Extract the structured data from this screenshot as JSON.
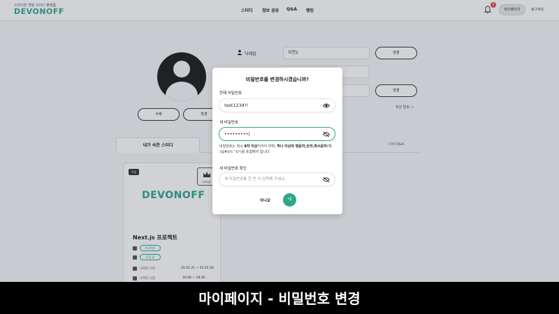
{
  "header": {
    "brand_tagline": "스터디한 개발 스터디 플랫폼",
    "brand_logo": "DEVONOFF",
    "nav": [
      "스터디",
      "정보 공유",
      "Q&A",
      "랭킹"
    ],
    "notification_count": "3",
    "mypage_label": "마이페이지",
    "logout_label": "로그아웃"
  },
  "profile": {
    "delete_label": "삭제",
    "change_label": "변경",
    "nickname_label": "닉네임",
    "nickname_value": "지연2",
    "edit_nickname_label": "변경",
    "edit_password_label": "변경",
    "withdraw_label": "회원 탈퇴 →"
  },
  "tabs": {
    "active": "내가 속한 스터디",
    "qa": "나의 Q&A"
  },
  "card": {
    "badge": "모집",
    "crown_label": "스터디장",
    "logo": "DEVONOFF",
    "title": "Next.js 프로젝트",
    "tag1": "프로젝트",
    "tag2": "모집 중",
    "period_label": "스터디 기간",
    "period_value": "25.01.21 ~ 25.02.28",
    "time_label": "스터디 시간",
    "time_value": "16:00 ~ 18:30"
  },
  "modal": {
    "title": "비밀번호를 변경하시겠습니까?",
    "current_label": "현재 비밀번호",
    "current_value": "test1234!!",
    "new_label": "새 비밀번호",
    "new_value": "•••••••••|",
    "hint_1": "비밀번호는 최소 ",
    "hint_2": "8자 이상",
    "hint_3": "이어야 하며, ",
    "hint_4": "하나 이상의 영문자,숫자,특수문자",
    "hint_5": "(예: !@#$%^&*)를 포함해야 합니다.",
    "confirm_label": "새 비밀번호 확인",
    "confirm_placeholder": "새 비밀번호를 한 번 더 입력해 주세요.",
    "no_label": "아니오",
    "yes_label": "네"
  },
  "caption": "마이페이지 - 비밀번호 변경",
  "colors": {
    "accent": "#2ea88a",
    "badge": "#e04848"
  }
}
